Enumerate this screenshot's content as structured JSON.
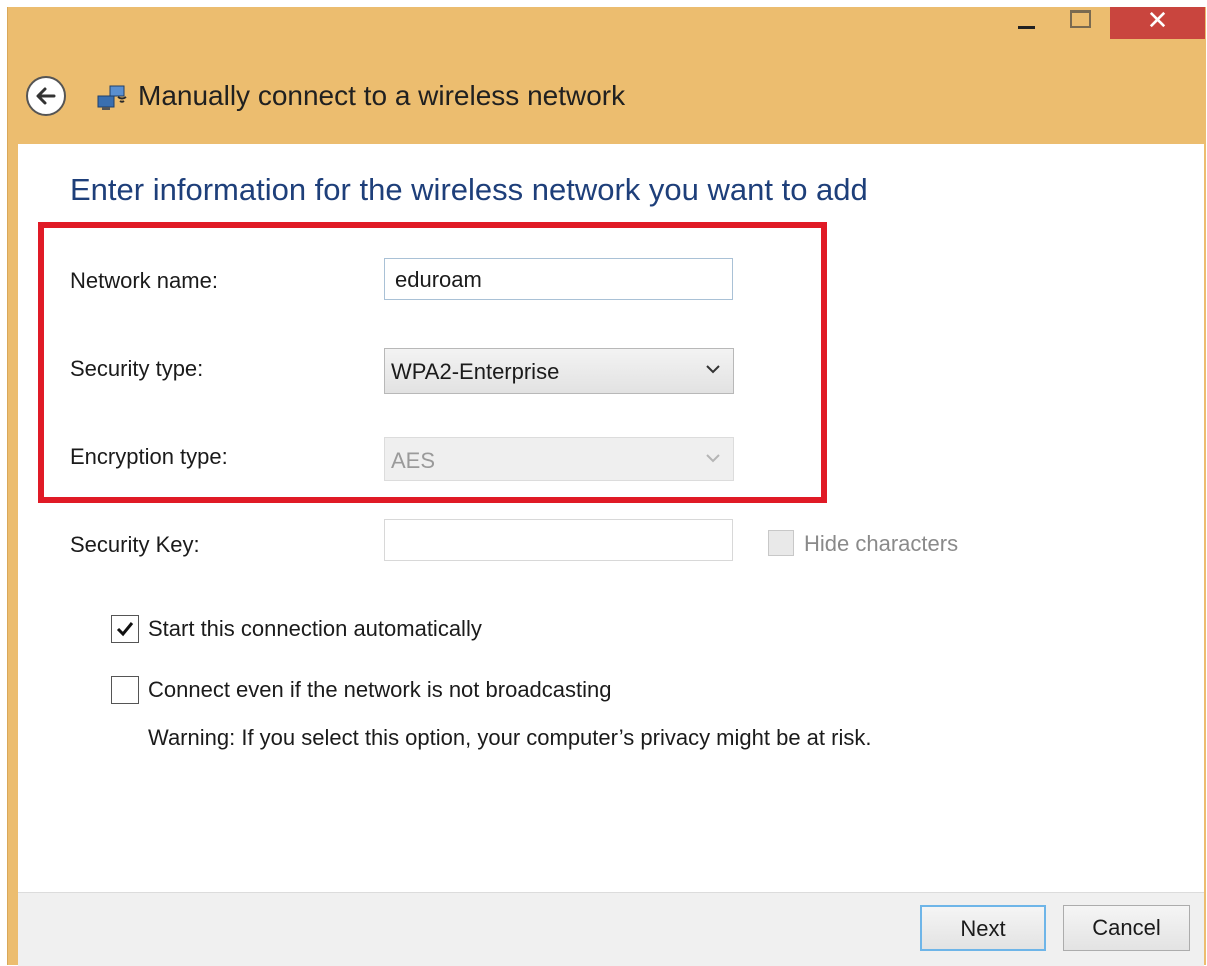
{
  "window": {
    "title": "Manually connect to a wireless network",
    "close_glyph": "✕"
  },
  "heading": "Enter information for the wireless network you want to add",
  "form": {
    "network_name": {
      "label": "Network name:",
      "value": "eduroam"
    },
    "security_type": {
      "label": "Security type:",
      "value": "WPA2-Enterprise"
    },
    "encryption_type": {
      "label": "Encryption type:",
      "value": "AES",
      "disabled": true
    },
    "security_key": {
      "label": "Security Key:",
      "value": ""
    },
    "hide_characters": {
      "label": "Hide characters",
      "checked": false,
      "disabled": true
    }
  },
  "options": {
    "start_auto": {
      "label": "Start this connection automatically",
      "checked": true
    },
    "connect_not_broadcasting": {
      "label": "Connect even if the network is not broadcasting",
      "checked": false
    },
    "warning": "Warning: If you select this option, your computer’s privacy might be at risk."
  },
  "buttons": {
    "next": "Next",
    "cancel": "Cancel"
  },
  "colors": {
    "titlebar": "#ecbd6f",
    "heading": "#1e3f7a",
    "highlight_box": "#e01a26",
    "close_button": "#c9453e",
    "default_button_border": "#6eb5e8"
  },
  "icons": [
    "back-arrow-icon",
    "wireless-network-icon",
    "minimize-icon",
    "maximize-icon",
    "close-icon",
    "chevron-down-icon",
    "checkmark-icon"
  ]
}
